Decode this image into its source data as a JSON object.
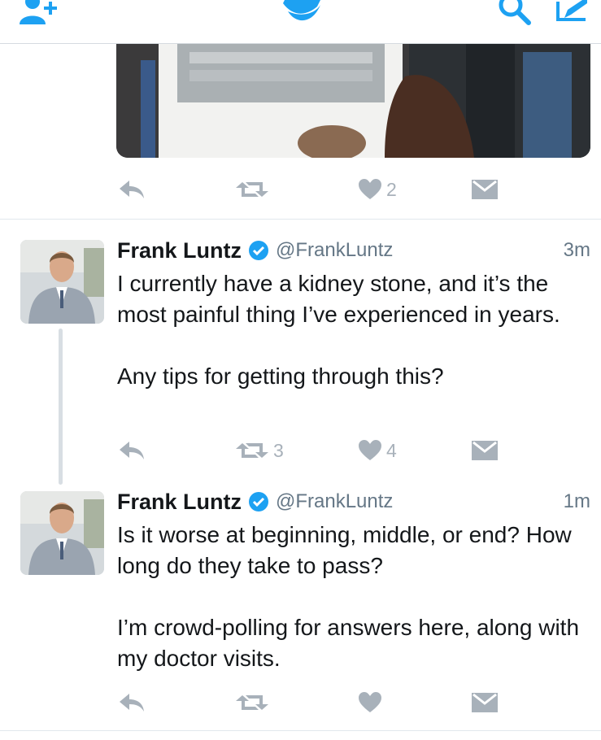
{
  "tweets": [
    {
      "name": "Frank Luntz",
      "handle": "@FrankLuntz",
      "time": "3m",
      "text": "I currently have a kidney stone, and it’s the most painful thing I’ve experienced in years.\n\nAny tips for getting through this?",
      "retweets": "3",
      "likes": "4"
    },
    {
      "name": "Frank Luntz",
      "handle": "@FrankLuntz",
      "time": "1m",
      "text": "Is it worse at beginning, middle, or end? How long do they take to pass?\n\nI’m crowd-polling for answers here, along with my doctor visits.",
      "retweets": "",
      "likes": ""
    }
  ],
  "previous_tweet": {
    "likes": "2"
  },
  "colors": {
    "twitter_blue": "#1da1f2",
    "action_gray": "#a8b1ba",
    "handle_gray": "#657786",
    "verified": "#1da1f2"
  },
  "icons": {
    "top_left": "add-user-icon",
    "top_center": "twitter-bird-icon",
    "search": "search-icon",
    "compose": "compose-icon"
  }
}
